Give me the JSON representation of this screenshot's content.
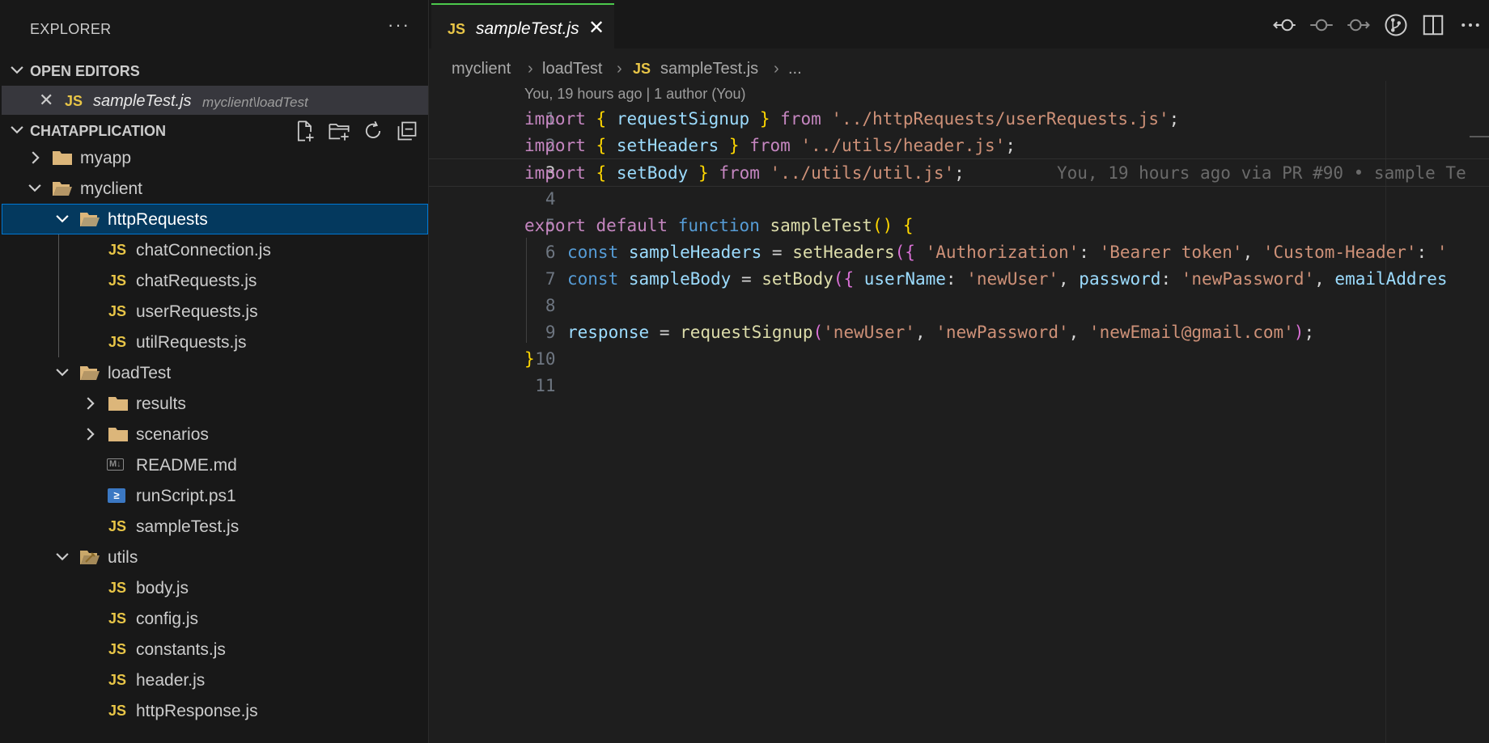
{
  "sidebar": {
    "title": "EXPLORER",
    "more": "···",
    "open_editors": {
      "label": "OPEN EDITORS",
      "items": [
        {
          "icon": "JS",
          "name": "sampleTest.js",
          "path": "myclient\\loadTest"
        }
      ]
    },
    "workspace": {
      "label": "CHATAPPLICATION",
      "tools": [
        "new-file-icon",
        "new-folder-icon",
        "refresh-icon",
        "collapse-all-icon"
      ]
    },
    "tree": [
      {
        "name": "myapp",
        "type": "folder",
        "expanded": false
      },
      {
        "name": "myclient",
        "type": "folder",
        "expanded": true
      },
      {
        "name": "httpRequests",
        "type": "folder",
        "expanded": true,
        "selected": true
      },
      {
        "name": "chatConnection.js",
        "type": "js"
      },
      {
        "name": "chatRequests.js",
        "type": "js"
      },
      {
        "name": "userRequests.js",
        "type": "js"
      },
      {
        "name": "utilRequests.js",
        "type": "js"
      },
      {
        "name": "loadTest",
        "type": "folder",
        "expanded": true
      },
      {
        "name": "results",
        "type": "folder",
        "expanded": false
      },
      {
        "name": "scenarios",
        "type": "folder",
        "expanded": false
      },
      {
        "name": "README.md",
        "type": "md"
      },
      {
        "name": "runScript.ps1",
        "type": "ps1"
      },
      {
        "name": "sampleTest.js",
        "type": "js"
      },
      {
        "name": "utils",
        "type": "folder",
        "expanded": true
      },
      {
        "name": "body.js",
        "type": "js"
      },
      {
        "name": "config.js",
        "type": "js"
      },
      {
        "name": "constants.js",
        "type": "js"
      },
      {
        "name": "header.js",
        "type": "js"
      },
      {
        "name": "httpResponse.js",
        "type": "js"
      }
    ],
    "icons": {
      "js_label": "JS",
      "md_label": "M↓",
      "ps_label": "≥"
    }
  },
  "editor": {
    "tab": {
      "icon": "JS",
      "name": "sampleTest.js"
    },
    "actions": [
      "previous-change-icon",
      "current-change-icon",
      "next-change-icon",
      "source-control-icon",
      "split-editor-icon",
      "more-actions-icon"
    ],
    "breadcrumb": [
      "myclient",
      "loadTest",
      "sampleTest.js",
      "..."
    ],
    "blame_header": "You, 19 hours ago | 1 author (You)",
    "inline_blame": "You, 19 hours ago via PR #90 • sample Te",
    "line_numbers": [
      "1",
      "2",
      "3",
      "4",
      "5",
      "6",
      "7",
      "8",
      "9",
      "10",
      "11"
    ],
    "active_line": 3,
    "code_tokens": {
      "l1": [
        "import",
        "{",
        "requestSignup",
        "}",
        "from",
        "'../httpRequests/userRequests.js'",
        ";"
      ],
      "l2": [
        "import",
        "{",
        "setHeaders",
        "}",
        "from",
        "'../utils/header.js'",
        ";"
      ],
      "l3": [
        "import",
        "{",
        "setBody",
        "}",
        "from",
        "'../utils/util.js'",
        ";"
      ],
      "l5": [
        "export",
        "default",
        "function",
        "sampleTest",
        "()",
        "{"
      ],
      "l6": [
        "const",
        "sampleHeaders",
        "=",
        "setHeaders",
        "({",
        "'Authorization'",
        ": ",
        "'Bearer token'",
        ", ",
        "'Custom-Header'",
        ": ",
        "'"
      ],
      "l7": [
        "const",
        "sampleBody",
        "=",
        "setBody",
        "({",
        "userName",
        ": ",
        "'newUser'",
        ", ",
        "password",
        ": ",
        "'newPassword'",
        ", ",
        "emailAddres"
      ],
      "l9": [
        "response",
        "=",
        "requestSignup",
        "(",
        "'newUser'",
        ", ",
        "'newPassword'",
        ", ",
        "'newEmail@gmail.com'",
        ")",
        ";"
      ],
      "l10": [
        "}"
      ]
    }
  },
  "colors": {
    "accent": "#4cc94c",
    "selection": "#04395e",
    "js_icon": "#e8c547",
    "folder": "#dcb67a"
  }
}
